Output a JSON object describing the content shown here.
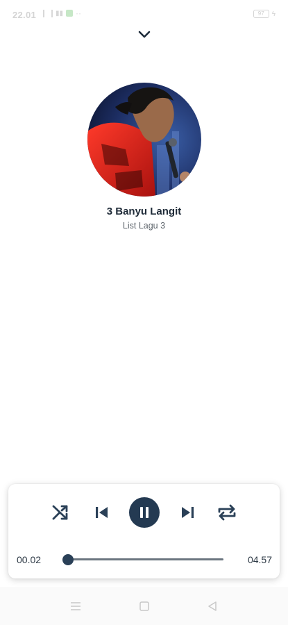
{
  "status_bar": {
    "time": "22.01",
    "battery": "97"
  },
  "header": {
    "collapse_icon": "chevron-down-icon"
  },
  "now_playing": {
    "title": "3 Banyu Langit",
    "subtitle": "List Lagu 3"
  },
  "player": {
    "current_time": "00.02",
    "total_time": "04.57",
    "progress": 0.0067,
    "state": "playing",
    "accent_color": "#243a52",
    "icons": {
      "shuffle": "shuffle-icon",
      "previous": "skip-previous-icon",
      "play_pause": "pause-icon",
      "next": "skip-next-icon",
      "repeat": "repeat-icon"
    }
  },
  "nav_bar": {
    "icons": [
      "menu-icon",
      "home-icon",
      "back-icon"
    ]
  }
}
